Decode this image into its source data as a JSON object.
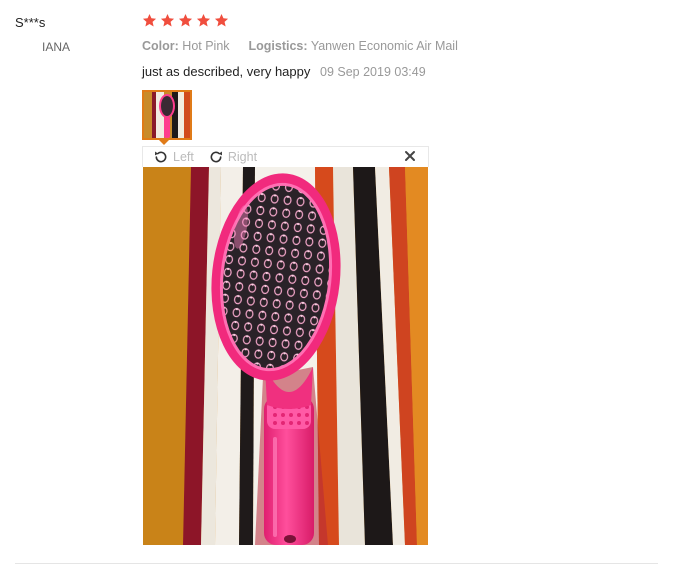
{
  "reviewer": {
    "name": "S***s",
    "country": "IANA"
  },
  "rating": {
    "stars": 5,
    "max": 5,
    "star_color": "#f04e3e"
  },
  "attributes": [
    {
      "key": "Color:",
      "value": "Hot Pink"
    },
    {
      "key": "Logistics:",
      "value": "Yanwen Economic Air Mail"
    }
  ],
  "review": {
    "text": "just as described, very happy",
    "date": "09 Sep 2019 03:49"
  },
  "viewer": {
    "left_label": "Left",
    "right_label": "Right",
    "close_icon": "close-icon"
  },
  "colors": {
    "accent": "#e07b18",
    "muted": "#999999"
  }
}
